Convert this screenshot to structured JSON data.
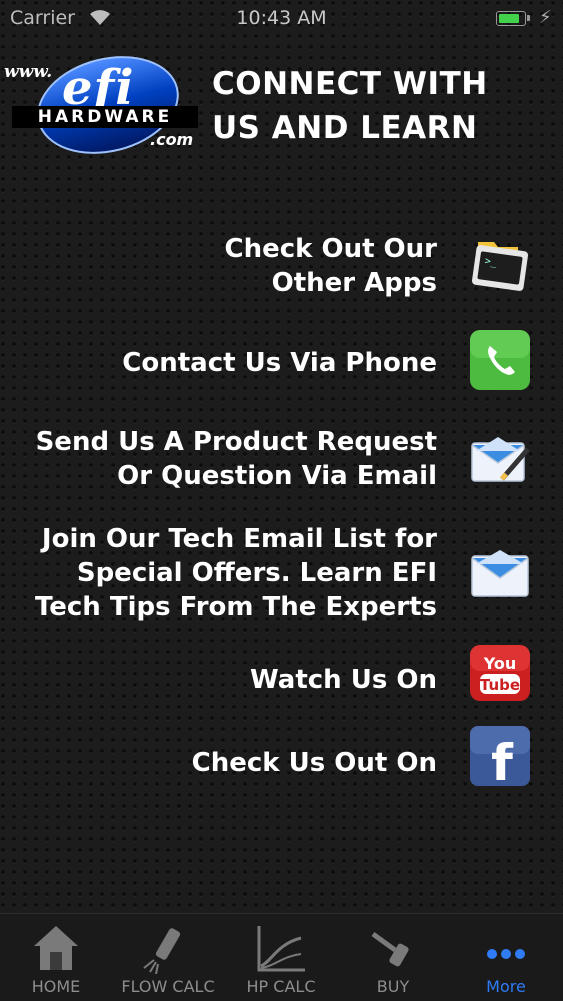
{
  "status_bar": {
    "carrier": "Carrier",
    "time": "10:43 AM"
  },
  "logo": {
    "www": "www.",
    "efi": "efi",
    "hardware": "HARDWARE",
    "com": ".com"
  },
  "header": {
    "title": "CONNECT WITH US AND LEARN"
  },
  "items": [
    {
      "label": "Check Out Our\nOther Apps",
      "icon": "terminal-app-icon"
    },
    {
      "label": "Contact Us Via Phone",
      "icon": "phone-icon"
    },
    {
      "label": "Send Us A Product Request\nOr Question Via Email",
      "icon": "email-pen-icon"
    },
    {
      "label": "Join Our Tech Email List for\nSpecial Offers. Learn EFI\nTech Tips From The Experts",
      "icon": "envelope-icon"
    },
    {
      "label": "Watch Us On",
      "icon": "youtube-icon",
      "icon_text": [
        "You",
        "Tube"
      ]
    },
    {
      "label": "Check Us Out On",
      "icon": "facebook-icon",
      "icon_text": "f"
    }
  ],
  "tabs": [
    {
      "label": "HOME",
      "icon": "house-icon",
      "active": false
    },
    {
      "label": "FLOW CALC",
      "icon": "injector-icon",
      "active": false
    },
    {
      "label": "HP CALC",
      "icon": "graph-icon",
      "active": false
    },
    {
      "label": "BUY",
      "icon": "tool-icon",
      "active": false
    },
    {
      "label": "More",
      "icon": "more-dots-icon",
      "active": true
    }
  ],
  "colors": {
    "accent": "#2f7cf6",
    "phone_green": "#4cbb3f",
    "youtube_red": "#cc1f1f",
    "facebook_blue": "#3b5998"
  }
}
